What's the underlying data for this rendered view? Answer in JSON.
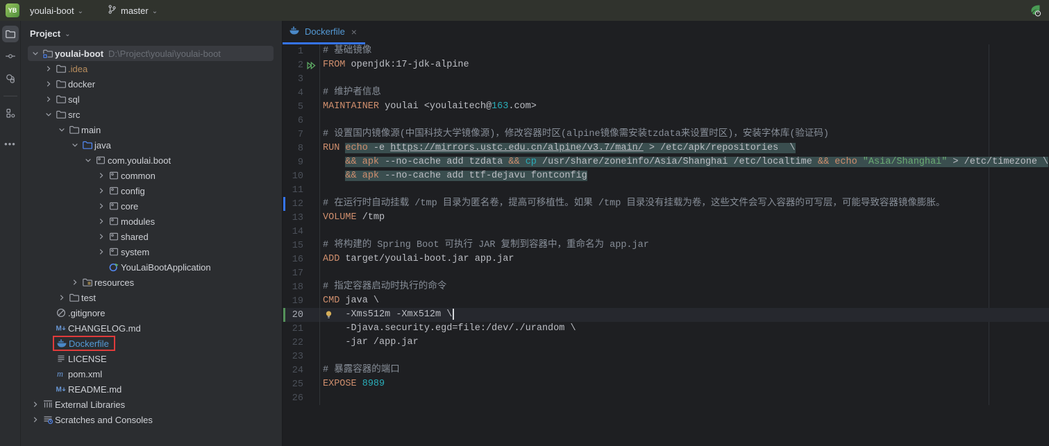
{
  "title_bar": {
    "logo": "YB",
    "project_name": "youlai-boot",
    "branch": "master"
  },
  "activity_bar": {
    "items": [
      "project",
      "commit",
      "pull-requests",
      "structure",
      "more"
    ]
  },
  "project_panel": {
    "header": "Project",
    "tree": [
      {
        "depth": 0,
        "chevron": "expanded",
        "icon": "folder-root",
        "label": "youlai-boot",
        "path": "D:\\Project\\youlai\\youlai-boot",
        "selected": true,
        "bold": true
      },
      {
        "depth": 1,
        "chevron": "collapsed",
        "icon": "folder",
        "label": ".idea",
        "color": "ignored"
      },
      {
        "depth": 1,
        "chevron": "collapsed",
        "icon": "folder",
        "label": "docker"
      },
      {
        "depth": 1,
        "chevron": "collapsed",
        "icon": "folder",
        "label": "sql"
      },
      {
        "depth": 1,
        "chevron": "expanded",
        "icon": "folder",
        "label": "src"
      },
      {
        "depth": 2,
        "chevron": "expanded",
        "icon": "folder",
        "label": "main"
      },
      {
        "depth": 3,
        "chevron": "expanded",
        "icon": "folder-source",
        "label": "java"
      },
      {
        "depth": 4,
        "chevron": "expanded",
        "icon": "package",
        "label": "com.youlai.boot"
      },
      {
        "depth": 5,
        "chevron": "collapsed",
        "icon": "package",
        "label": "common"
      },
      {
        "depth": 5,
        "chevron": "collapsed",
        "icon": "package",
        "label": "config"
      },
      {
        "depth": 5,
        "chevron": "collapsed",
        "icon": "package",
        "label": "core"
      },
      {
        "depth": 5,
        "chevron": "collapsed",
        "icon": "package",
        "label": "modules"
      },
      {
        "depth": 5,
        "chevron": "collapsed",
        "icon": "package",
        "label": "shared"
      },
      {
        "depth": 5,
        "chevron": "collapsed",
        "icon": "package",
        "label": "system"
      },
      {
        "depth": 5,
        "chevron": null,
        "icon": "class-run",
        "label": "YouLaiBootApplication"
      },
      {
        "depth": 3,
        "chevron": "collapsed",
        "icon": "folder-resources",
        "label": "resources"
      },
      {
        "depth": 2,
        "chevron": "collapsed",
        "icon": "folder",
        "label": "test"
      },
      {
        "depth": 1,
        "chevron": null,
        "icon": "ignored",
        "label": ".gitignore"
      },
      {
        "depth": 1,
        "chevron": null,
        "icon": "markdown",
        "label": "CHANGELOG.md"
      },
      {
        "depth": 1,
        "chevron": null,
        "icon": "docker",
        "label": "Dockerfile",
        "color": "modified",
        "annotated": true
      },
      {
        "depth": 1,
        "chevron": null,
        "icon": "license",
        "label": "LICENSE"
      },
      {
        "depth": 1,
        "chevron": null,
        "icon": "maven",
        "label": "pom.xml"
      },
      {
        "depth": 1,
        "chevron": null,
        "icon": "markdown",
        "label": "README.md"
      },
      {
        "depth": 0,
        "chevron": "collapsed",
        "icon": "library",
        "label": "External Libraries"
      },
      {
        "depth": 0,
        "chevron": "collapsed",
        "icon": "scratches",
        "label": "Scratches and Consoles"
      }
    ]
  },
  "editor": {
    "tab": {
      "label": "Dockerfile",
      "icon": "docker",
      "close_glyph": "×"
    },
    "lines": [
      {
        "n": 1,
        "segs": [
          [
            "# 基础镜像",
            "cmt"
          ]
        ]
      },
      {
        "n": 2,
        "gutter": "run",
        "segs": [
          [
            "FROM",
            "kw"
          ],
          [
            " openjdk:17-jdk-alpine",
            "def"
          ]
        ]
      },
      {
        "n": 3,
        "segs": []
      },
      {
        "n": 4,
        "segs": [
          [
            "# 维护者信息",
            "cmt"
          ]
        ]
      },
      {
        "n": 5,
        "segs": [
          [
            "MAINTAINER",
            "kw"
          ],
          [
            " youlai <youlaitech@",
            "def"
          ],
          [
            "163",
            "num"
          ],
          [
            ".com>",
            "def"
          ]
        ]
      },
      {
        "n": 6,
        "segs": []
      },
      {
        "n": 7,
        "segs": [
          [
            "# 设置国内镜像源(中国科技大学镜像源)，修改容器时区(alpine镜像需安装tzdata来设置时区)，安装字体库(验证码)",
            "cmt"
          ]
        ]
      },
      {
        "n": 8,
        "segs": [
          [
            "RUN ",
            "kw"
          ],
          [
            "echo",
            "kw inj"
          ],
          [
            " -e ",
            "def inj"
          ],
          [
            "https://mirrors.ustc.edu.cn/alpine/v3.7/main/",
            "url inj"
          ],
          [
            " > /etc/apk/repositories  \\",
            "def inj"
          ]
        ]
      },
      {
        "n": 9,
        "segs": [
          [
            "    ",
            "def"
          ],
          [
            "&&",
            "kw inj"
          ],
          [
            " ",
            "def inj"
          ],
          [
            "apk",
            "kw inj"
          ],
          [
            " --no-cache add tzdata ",
            "def inj"
          ],
          [
            "&&",
            "kw inj"
          ],
          [
            " ",
            "def inj"
          ],
          [
            "cp",
            "num inj"
          ],
          [
            " /usr/share/zoneinfo/Asia/Shanghai /etc/localtime ",
            "def inj"
          ],
          [
            "&&",
            "kw inj"
          ],
          [
            " ",
            "def inj"
          ],
          [
            "echo",
            "kw inj"
          ],
          [
            " ",
            "def inj"
          ],
          [
            "\"Asia/Shanghai\"",
            "str inj"
          ],
          [
            " > /etc/timezone \\",
            "def inj"
          ]
        ]
      },
      {
        "n": 10,
        "segs": [
          [
            "    ",
            "def"
          ],
          [
            "&&",
            "kw inj"
          ],
          [
            " ",
            "def inj"
          ],
          [
            "apk",
            "kw inj"
          ],
          [
            " --no-cache add ttf-dejavu fontconfig",
            "def inj"
          ]
        ]
      },
      {
        "n": 11,
        "segs": []
      },
      {
        "n": 12,
        "marker": "blue",
        "segs": [
          [
            "# 在运行时自动挂载 /tmp 目录为匿名卷，提高可移植性。如果 /tmp 目录没有挂载为卷，这些文件会写入容器的可写层，可能导致容器镜像膨胀。",
            "cmt"
          ]
        ]
      },
      {
        "n": 13,
        "segs": [
          [
            "VOLUME",
            "kw"
          ],
          [
            " /tmp",
            "def"
          ]
        ]
      },
      {
        "n": 14,
        "segs": []
      },
      {
        "n": 15,
        "segs": [
          [
            "# 将构建的 Spring Boot 可执行 JAR 复制到容器中，重命名为 app.jar",
            "cmt"
          ]
        ]
      },
      {
        "n": 16,
        "segs": [
          [
            "ADD",
            "kw"
          ],
          [
            " target/youlai-boot.jar app.jar",
            "def"
          ]
        ]
      },
      {
        "n": 17,
        "segs": []
      },
      {
        "n": 18,
        "segs": [
          [
            "# 指定容器启动时执行的命令",
            "cmt"
          ]
        ]
      },
      {
        "n": 19,
        "segs": [
          [
            "CMD",
            "kw"
          ],
          [
            " java \\",
            "def"
          ]
        ]
      },
      {
        "n": 20,
        "marker": "green",
        "current": true,
        "bulb": true,
        "caret": true,
        "segs": [
          [
            "    -Xms512m -Xmx512m \\",
            "def"
          ]
        ]
      },
      {
        "n": 21,
        "segs": [
          [
            "    -Djava.security.egd=file:/dev/./urandom \\",
            "def"
          ]
        ]
      },
      {
        "n": 22,
        "segs": [
          [
            "    -jar /app.jar",
            "def"
          ]
        ]
      },
      {
        "n": 23,
        "segs": []
      },
      {
        "n": 24,
        "segs": [
          [
            "# 暴露容器的端口",
            "cmt"
          ]
        ]
      },
      {
        "n": 25,
        "segs": [
          [
            "EXPOSE",
            "kw"
          ],
          [
            " ",
            "def"
          ],
          [
            "8989",
            "num"
          ]
        ]
      },
      {
        "n": 26,
        "segs": []
      }
    ]
  },
  "colors": {
    "editor_bg": "#1E1F22",
    "panel_bg": "#2B2D30",
    "keyword": "#CF8E6D",
    "comment": "#878E98",
    "string": "#6AAB73",
    "number": "#2AACB8",
    "default_text": "#BCBEC4",
    "modified_file_blue": "#549AD6",
    "ignored_file_tan": "#B98E5E",
    "tab_underline": "#3574F0",
    "run_block_highlight": "#3A4E4F",
    "annotation_red": "#E03B3B",
    "vcs_added_green": "#549159",
    "vcs_changed_blue": "#3574F0"
  }
}
